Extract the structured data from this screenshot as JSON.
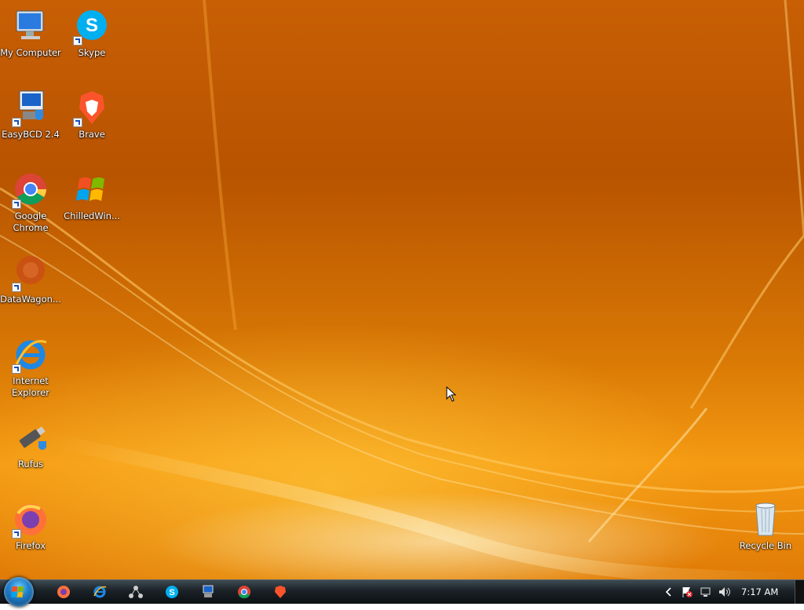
{
  "desktop": {
    "icons": [
      {
        "label": "My Computer",
        "icon": "my-computer-icon"
      },
      {
        "label": "Skype",
        "icon": "skype-icon"
      },
      {
        "label": "EasyBCD 2.4",
        "icon": "easybcd-icon"
      },
      {
        "label": "Brave",
        "icon": "brave-icon"
      },
      {
        "label": "Google Chrome",
        "icon": "chrome-icon"
      },
      {
        "label": "ChilledWin...",
        "icon": "windows-logo-icon"
      },
      {
        "label": "DataWagon...",
        "icon": "datawagon-icon"
      },
      {
        "label": "Internet Explorer",
        "icon": "internet-explorer-icon"
      },
      {
        "label": "Rufus",
        "icon": "usb-drive-icon"
      },
      {
        "label": "Firefox",
        "icon": "firefox-icon"
      },
      {
        "label": "Recycle Bin",
        "icon": "recycle-bin-icon"
      }
    ]
  },
  "taskbar": {
    "pinned": [
      "firefox-icon",
      "internet-explorer-icon",
      "network-icon",
      "skype-icon",
      "easybcd-icon",
      "chrome-icon",
      "brave-icon"
    ],
    "tray": [
      "chevron-left-icon",
      "action-center-flag-icon",
      "network-status-icon",
      "volume-icon"
    ],
    "clock": "7:17 AM"
  },
  "colors": {
    "wallpaper_base": "#c85f05",
    "wallpaper_highlight": "#f59a12",
    "taskbar": "#1b2227"
  }
}
